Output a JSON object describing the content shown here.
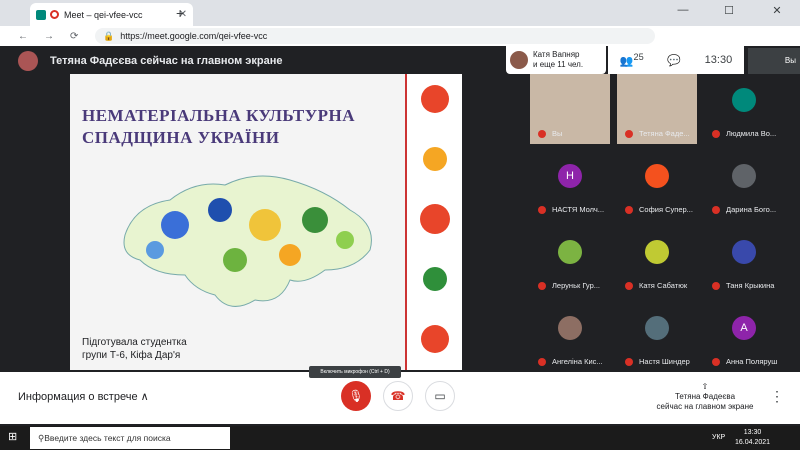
{
  "browser": {
    "tab_title": "Meet – qei-vfee-vcc",
    "url": "https://meet.google.com/qei-vfee-vcc"
  },
  "meet_header": {
    "presenter_text": "Тетяна Фадєєва сейчас на главном экране",
    "popup_line1": "Катя Вапняр",
    "popup_line2": "и еще 11 чел.",
    "participant_count": "25",
    "time": "13:30",
    "self_label": "Вы"
  },
  "slide": {
    "title_line1": "НЕМАТЕРІАЛЬНА КУЛЬТУРНА",
    "title_line2": "СПАДЩИНА УКРАЇНИ",
    "sub_line1": "Підготувала студентка",
    "sub_line2": "групи Т-6, Кіфа Дар'я"
  },
  "participants": [
    {
      "name": "Вы",
      "avatar": "",
      "video": true
    },
    {
      "name": "Тетяна Фаде...",
      "avatar": "",
      "video": true
    },
    {
      "name": "Людмила Во...",
      "avatar": "",
      "video": false
    },
    {
      "name": "НАСТЯ Молч...",
      "avatar": "Н",
      "video": false
    },
    {
      "name": "София Супер...",
      "avatar": "",
      "video": false
    },
    {
      "name": "Дарина Бого...",
      "avatar": "",
      "video": false
    },
    {
      "name": "Леруньк Гур...",
      "avatar": "",
      "video": false
    },
    {
      "name": "Катя Сабатюк",
      "avatar": "",
      "video": false
    },
    {
      "name": "Таня Крыкина",
      "avatar": "",
      "video": false
    },
    {
      "name": "Ангеліна Кис...",
      "avatar": "",
      "video": false
    },
    {
      "name": "Настя Шиндер",
      "avatar": "",
      "video": false
    },
    {
      "name": "Анна Поляруш",
      "avatar": "А",
      "video": false
    }
  ],
  "bottom": {
    "meeting_info": "Информация о встрече",
    "mic_tooltip": "Включить микрофон (Ctrl + D)",
    "presenter_line1": "Тетяна Фадеєва",
    "presenter_line2": "сейчас на главном экране"
  },
  "taskbar": {
    "search_placeholder": "Введите здесь текст для поиска",
    "lang": "УКР",
    "time": "13:30",
    "date": "16.04.2021"
  }
}
